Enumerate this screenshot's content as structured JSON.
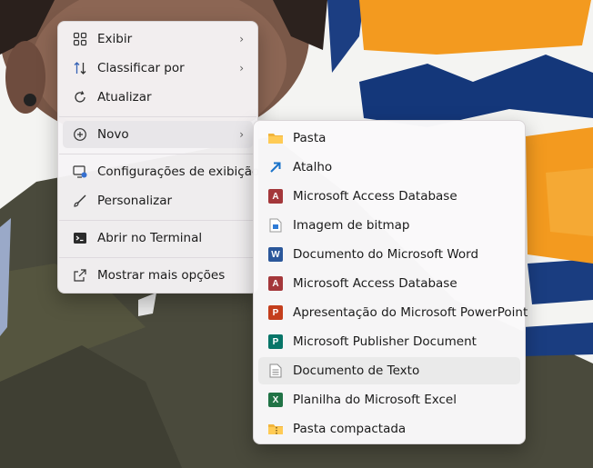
{
  "desktop": {
    "colors": {
      "brand_orange": "#f39a1f",
      "brand_navy": "#14377a",
      "shirt": "#4a4a3c"
    }
  },
  "context_menu": {
    "items": [
      {
        "label": "Exibir",
        "icon": "grid-icon",
        "has_submenu": true
      },
      {
        "label": "Classificar por",
        "icon": "sort-icon",
        "has_submenu": true
      },
      {
        "label": "Atualizar",
        "icon": "refresh-icon",
        "has_submenu": false
      },
      {
        "label": "Novo",
        "icon": "plus-circle-icon",
        "has_submenu": true
      },
      {
        "label": "Configurações de exibição",
        "icon": "display-settings-icon",
        "has_submenu": false
      },
      {
        "label": "Personalizar",
        "icon": "brush-icon",
        "has_submenu": false
      },
      {
        "label": "Abrir no Terminal",
        "icon": "terminal-icon",
        "has_submenu": false
      },
      {
        "label": "Mostrar mais opções",
        "icon": "open-external-icon",
        "has_submenu": false
      }
    ]
  },
  "new_submenu": {
    "items": [
      {
        "label": "Pasta",
        "icon": "folder-icon"
      },
      {
        "label": "Atalho",
        "icon": "shortcut-icon"
      },
      {
        "label": "Microsoft Access Database",
        "icon": "access-icon"
      },
      {
        "label": "Imagem de bitmap",
        "icon": "bitmap-icon"
      },
      {
        "label": "Documento do Microsoft Word",
        "icon": "word-icon"
      },
      {
        "label": "Microsoft Access Database",
        "icon": "access-icon"
      },
      {
        "label": "Apresentação do Microsoft PowerPoint",
        "icon": "powerpoint-icon"
      },
      {
        "label": "Microsoft Publisher Document",
        "icon": "publisher-icon"
      },
      {
        "label": "Documento de Texto",
        "icon": "text-document-icon"
      },
      {
        "label": "Planilha do Microsoft Excel",
        "icon": "excel-icon"
      },
      {
        "label": "Pasta compactada",
        "icon": "zip-folder-icon"
      }
    ]
  }
}
